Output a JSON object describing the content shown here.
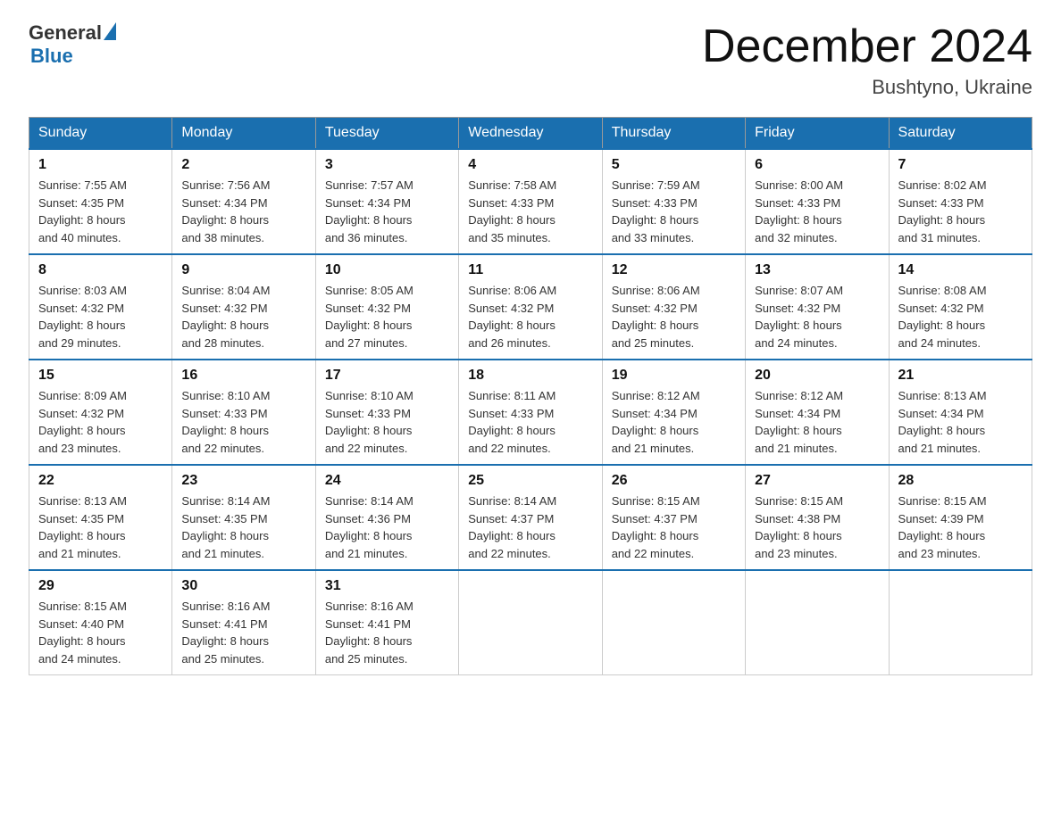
{
  "logo": {
    "general": "General",
    "blue": "Blue"
  },
  "title": {
    "month": "December 2024",
    "location": "Bushtyno, Ukraine"
  },
  "weekdays": [
    "Sunday",
    "Monday",
    "Tuesday",
    "Wednesday",
    "Thursday",
    "Friday",
    "Saturday"
  ],
  "weeks": [
    [
      {
        "day": "1",
        "sunrise": "7:55 AM",
        "sunset": "4:35 PM",
        "daylight": "8 hours and 40 minutes."
      },
      {
        "day": "2",
        "sunrise": "7:56 AM",
        "sunset": "4:34 PM",
        "daylight": "8 hours and 38 minutes."
      },
      {
        "day": "3",
        "sunrise": "7:57 AM",
        "sunset": "4:34 PM",
        "daylight": "8 hours and 36 minutes."
      },
      {
        "day": "4",
        "sunrise": "7:58 AM",
        "sunset": "4:33 PM",
        "daylight": "8 hours and 35 minutes."
      },
      {
        "day": "5",
        "sunrise": "7:59 AM",
        "sunset": "4:33 PM",
        "daylight": "8 hours and 33 minutes."
      },
      {
        "day": "6",
        "sunrise": "8:00 AM",
        "sunset": "4:33 PM",
        "daylight": "8 hours and 32 minutes."
      },
      {
        "day": "7",
        "sunrise": "8:02 AM",
        "sunset": "4:33 PM",
        "daylight": "8 hours and 31 minutes."
      }
    ],
    [
      {
        "day": "8",
        "sunrise": "8:03 AM",
        "sunset": "4:32 PM",
        "daylight": "8 hours and 29 minutes."
      },
      {
        "day": "9",
        "sunrise": "8:04 AM",
        "sunset": "4:32 PM",
        "daylight": "8 hours and 28 minutes."
      },
      {
        "day": "10",
        "sunrise": "8:05 AM",
        "sunset": "4:32 PM",
        "daylight": "8 hours and 27 minutes."
      },
      {
        "day": "11",
        "sunrise": "8:06 AM",
        "sunset": "4:32 PM",
        "daylight": "8 hours and 26 minutes."
      },
      {
        "day": "12",
        "sunrise": "8:06 AM",
        "sunset": "4:32 PM",
        "daylight": "8 hours and 25 minutes."
      },
      {
        "day": "13",
        "sunrise": "8:07 AM",
        "sunset": "4:32 PM",
        "daylight": "8 hours and 24 minutes."
      },
      {
        "day": "14",
        "sunrise": "8:08 AM",
        "sunset": "4:32 PM",
        "daylight": "8 hours and 24 minutes."
      }
    ],
    [
      {
        "day": "15",
        "sunrise": "8:09 AM",
        "sunset": "4:32 PM",
        "daylight": "8 hours and 23 minutes."
      },
      {
        "day": "16",
        "sunrise": "8:10 AM",
        "sunset": "4:33 PM",
        "daylight": "8 hours and 22 minutes."
      },
      {
        "day": "17",
        "sunrise": "8:10 AM",
        "sunset": "4:33 PM",
        "daylight": "8 hours and 22 minutes."
      },
      {
        "day": "18",
        "sunrise": "8:11 AM",
        "sunset": "4:33 PM",
        "daylight": "8 hours and 22 minutes."
      },
      {
        "day": "19",
        "sunrise": "8:12 AM",
        "sunset": "4:34 PM",
        "daylight": "8 hours and 21 minutes."
      },
      {
        "day": "20",
        "sunrise": "8:12 AM",
        "sunset": "4:34 PM",
        "daylight": "8 hours and 21 minutes."
      },
      {
        "day": "21",
        "sunrise": "8:13 AM",
        "sunset": "4:34 PM",
        "daylight": "8 hours and 21 minutes."
      }
    ],
    [
      {
        "day": "22",
        "sunrise": "8:13 AM",
        "sunset": "4:35 PM",
        "daylight": "8 hours and 21 minutes."
      },
      {
        "day": "23",
        "sunrise": "8:14 AM",
        "sunset": "4:35 PM",
        "daylight": "8 hours and 21 minutes."
      },
      {
        "day": "24",
        "sunrise": "8:14 AM",
        "sunset": "4:36 PM",
        "daylight": "8 hours and 21 minutes."
      },
      {
        "day": "25",
        "sunrise": "8:14 AM",
        "sunset": "4:37 PM",
        "daylight": "8 hours and 22 minutes."
      },
      {
        "day": "26",
        "sunrise": "8:15 AM",
        "sunset": "4:37 PM",
        "daylight": "8 hours and 22 minutes."
      },
      {
        "day": "27",
        "sunrise": "8:15 AM",
        "sunset": "4:38 PM",
        "daylight": "8 hours and 23 minutes."
      },
      {
        "day": "28",
        "sunrise": "8:15 AM",
        "sunset": "4:39 PM",
        "daylight": "8 hours and 23 minutes."
      }
    ],
    [
      {
        "day": "29",
        "sunrise": "8:15 AM",
        "sunset": "4:40 PM",
        "daylight": "8 hours and 24 minutes."
      },
      {
        "day": "30",
        "sunrise": "8:16 AM",
        "sunset": "4:41 PM",
        "daylight": "8 hours and 25 minutes."
      },
      {
        "day": "31",
        "sunrise": "8:16 AM",
        "sunset": "4:41 PM",
        "daylight": "8 hours and 25 minutes."
      },
      null,
      null,
      null,
      null
    ]
  ],
  "labels": {
    "sunrise": "Sunrise:",
    "sunset": "Sunset:",
    "daylight": "Daylight:"
  }
}
